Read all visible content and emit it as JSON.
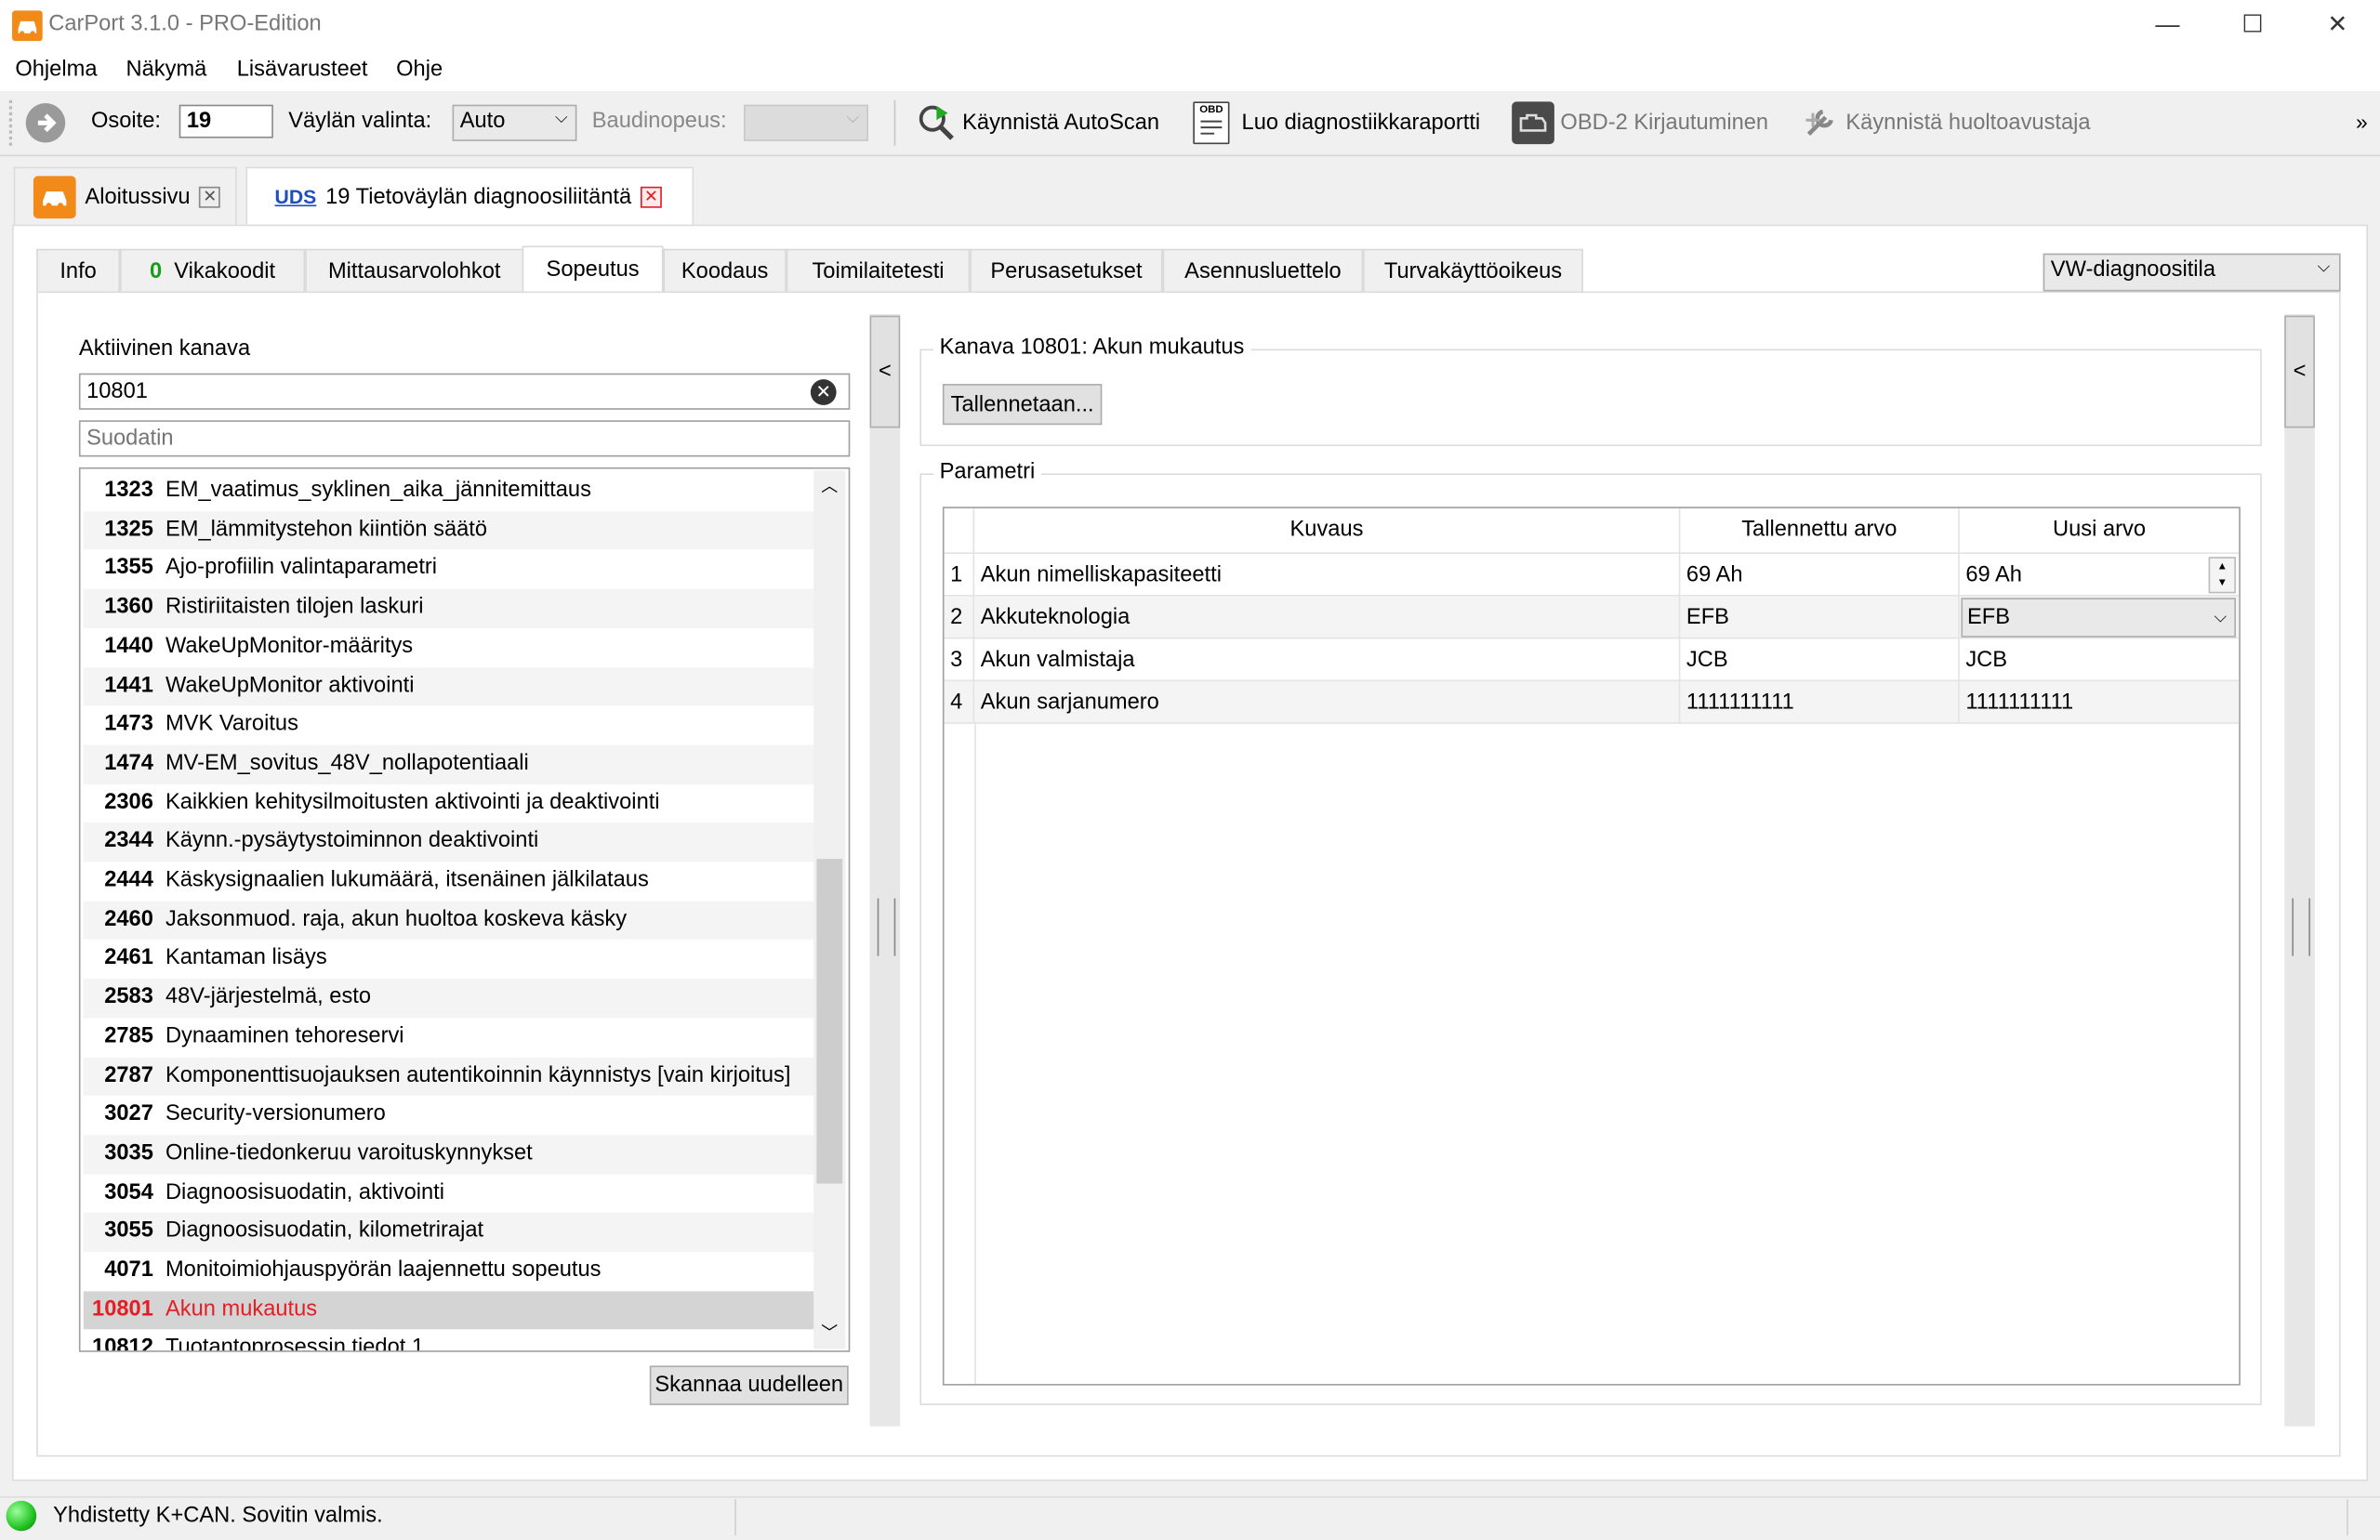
{
  "window": {
    "title": "CarPort 3.1.0 - PRO-Edition",
    "minimize": "—",
    "maximize": "☐",
    "close": "✕"
  },
  "menu": [
    "Ohjelma",
    "Näkymä",
    "Lisävarusteet",
    "Ohje"
  ],
  "toolbar": {
    "address_label": "Osoite:",
    "address_value": "19",
    "bus_label": "Väylän valinta:",
    "bus_value": "Auto",
    "baud_label": "Baudinopeus:",
    "baud_value": "",
    "autoscan": "Käynnistä AutoScan",
    "report": "Luo diagnostiikkaraportti",
    "obd_login": "OBD-2 Kirjautuminen",
    "service": "Käynnistä huoltoavustaja",
    "overflow": "»",
    "obd_icon_text": "OBD"
  },
  "doc_tabs": [
    {
      "label": "Aloitussivu"
    },
    {
      "badge": "UDS",
      "label": "19 Tietoväylän diagnoosiliitäntä"
    }
  ],
  "sub_tabs": [
    {
      "label": "Info"
    },
    {
      "count": "0",
      "label": "Vikakoodit"
    },
    {
      "label": "Mittausarvolohkot"
    },
    {
      "label": "Sopeutus"
    },
    {
      "label": "Koodaus"
    },
    {
      "label": "Toimilaitetesti"
    },
    {
      "label": "Perusasetukset"
    },
    {
      "label": "Asennusluettelo"
    },
    {
      "label": "Turvakäyttöoikeus"
    }
  ],
  "mode_select": "VW-diagnoositila",
  "left": {
    "active_channel_label": "Aktiivinen kanava",
    "channel_value": "10801",
    "filter_placeholder": "Suodatin",
    "rescan_button": "Skannaa uudelleen",
    "items": [
      {
        "code": "1323",
        "name": "EM_vaatimus_syklinen_aika_jännitemittaus"
      },
      {
        "code": "1325",
        "name": "EM_lämmitystehon kiintiön säätö"
      },
      {
        "code": "1355",
        "name": "Ajo-profiilin valintaparametri"
      },
      {
        "code": "1360",
        "name": "Ristiriitaisten tilojen laskuri"
      },
      {
        "code": "1440",
        "name": "WakeUpMonitor-määritys"
      },
      {
        "code": "1441",
        "name": "WakeUpMonitor aktivointi"
      },
      {
        "code": "1473",
        "name": "MVK Varoitus"
      },
      {
        "code": "1474",
        "name": "MV-EM_sovitus_48V_nollapotentiaali"
      },
      {
        "code": "2306",
        "name": "Kaikkien kehitysilmoitusten aktivointi ja deaktivointi"
      },
      {
        "code": "2344",
        "name": "Käynn.-pysäytystoiminnon deaktivointi"
      },
      {
        "code": "2444",
        "name": "Käskysignaalien lukumäärä, itsenäinen jälkilataus"
      },
      {
        "code": "2460",
        "name": "Jaksonmuod. raja, akun huoltoa koskeva käsky"
      },
      {
        "code": "2461",
        "name": "Kantaman lisäys"
      },
      {
        "code": "2583",
        "name": "48V-järjestelmä, esto"
      },
      {
        "code": "2785",
        "name": "Dynaaminen tehoreservi"
      },
      {
        "code": "2787",
        "name": "Komponenttisuojauksen autentikoinnin käynnistys [vain kirjoitus]"
      },
      {
        "code": "3027",
        "name": "Security-versionumero"
      },
      {
        "code": "3035",
        "name": "Online-tiedonkeruu varoituskynnykset"
      },
      {
        "code": "3054",
        "name": "Diagnoosisuodatin, aktivointi"
      },
      {
        "code": "3055",
        "name": "Diagnoosisuodatin, kilometrirajat"
      },
      {
        "code": "4071",
        "name": "Monitoimiohjauspyörän laajennettu sopeutus"
      },
      {
        "code": "10801",
        "name": "Akun mukautus"
      },
      {
        "code": "10812",
        "name": "Tuotantoprosessin tiedot 1"
      }
    ],
    "selected_index": 21
  },
  "right": {
    "channel_title": "Kanava 10801: Akun mukautus",
    "save_button": "Tallennetaan...",
    "params_title": "Parametri",
    "columns": [
      "Kuvaus",
      "Tallennettu arvo",
      "Uusi arvo"
    ],
    "rows": [
      {
        "n": "1",
        "desc": "Akun nimelliskapasiteetti",
        "stored": "69 Ah",
        "new": "69 Ah"
      },
      {
        "n": "2",
        "desc": "Akkuteknologia",
        "stored": "EFB",
        "new": "EFB"
      },
      {
        "n": "3",
        "desc": "Akun valmistaja",
        "stored": "JCB",
        "new": "JCB"
      },
      {
        "n": "4",
        "desc": "Akun sarjanumero",
        "stored": "1111111111",
        "new": "1111111111"
      }
    ]
  },
  "collapse_glyph": "<",
  "status": {
    "text": "Yhdistetty K+CAN. Sovitin valmis.",
    "led_color": "#22c322"
  },
  "colors": {
    "accent_orange": "#f28a1a",
    "selected_red": "#e31e24",
    "uds_blue": "#1f4fbf",
    "count_green": "#1a9c1a"
  }
}
